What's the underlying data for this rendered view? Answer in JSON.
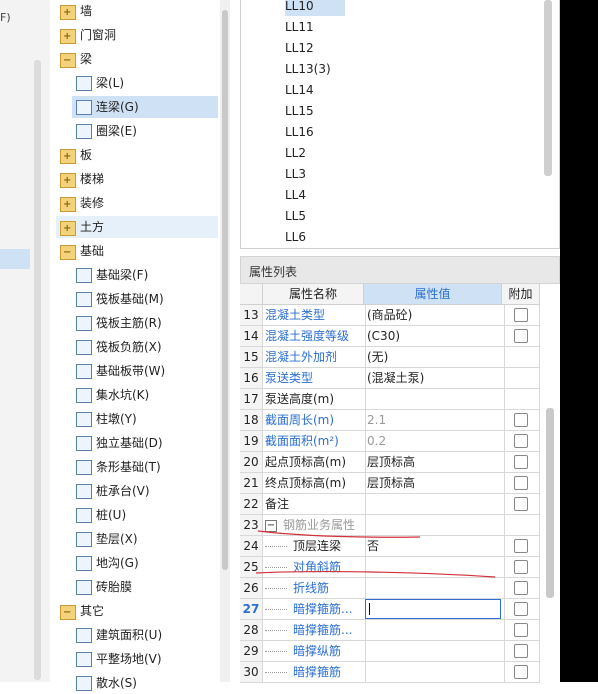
{
  "left_strip": {
    "fragment": "F)"
  },
  "tree": {
    "items": [
      {
        "label": "墙",
        "type": "folder",
        "icon": "folder-plus-icon"
      },
      {
        "label": "门窗洞",
        "type": "folder",
        "icon": "folder-plus-icon"
      },
      {
        "label": "梁",
        "type": "folder-open",
        "icon": "folder-minus-icon"
      },
      {
        "label": "梁(L)",
        "type": "leaf",
        "icon": "beam-icon"
      },
      {
        "label": "连梁(G)",
        "type": "leaf",
        "icon": "link-beam-icon",
        "selected": true
      },
      {
        "label": "圈梁(E)",
        "type": "leaf",
        "icon": "ring-beam-icon"
      },
      {
        "label": "板",
        "type": "folder",
        "icon": "folder-plus-icon"
      },
      {
        "label": "楼梯",
        "type": "folder",
        "icon": "folder-plus-icon"
      },
      {
        "label": "装修",
        "type": "folder",
        "icon": "folder-plus-icon"
      },
      {
        "label": "土方",
        "type": "folder",
        "icon": "folder-plus-icon",
        "hover": true
      },
      {
        "label": "基础",
        "type": "folder-open",
        "icon": "folder-minus-icon"
      },
      {
        "label": "基础梁(F)",
        "type": "leaf",
        "icon": "foundation-beam-icon"
      },
      {
        "label": "筏板基础(M)",
        "type": "leaf",
        "icon": "raft-foundation-icon"
      },
      {
        "label": "筏板主筋(R)",
        "type": "leaf",
        "icon": "raft-main-rebar-icon"
      },
      {
        "label": "筏板负筋(X)",
        "type": "leaf",
        "icon": "raft-negative-rebar-icon"
      },
      {
        "label": "基础板带(W)",
        "type": "leaf",
        "icon": "foundation-strip-icon"
      },
      {
        "label": "集水坑(K)",
        "type": "leaf",
        "icon": "sump-pit-icon"
      },
      {
        "label": "柱墩(Y)",
        "type": "leaf",
        "icon": "column-pier-icon"
      },
      {
        "label": "独立基础(D)",
        "type": "leaf",
        "icon": "isolated-footing-icon"
      },
      {
        "label": "条形基础(T)",
        "type": "leaf",
        "icon": "strip-footing-icon"
      },
      {
        "label": "桩承台(V)",
        "type": "leaf",
        "icon": "pile-cap-icon"
      },
      {
        "label": "桩(U)",
        "type": "leaf",
        "icon": "pile-icon"
      },
      {
        "label": "垫层(X)",
        "type": "leaf",
        "icon": "cushion-icon"
      },
      {
        "label": "地沟(G)",
        "type": "leaf",
        "icon": "trench-icon"
      },
      {
        "label": "砖胎膜",
        "type": "leaf",
        "icon": "brick-mold-icon"
      },
      {
        "label": "其它",
        "type": "folder-open",
        "icon": "folder-minus-icon"
      },
      {
        "label": "建筑面积(U)",
        "type": "leaf",
        "icon": "building-area-icon"
      },
      {
        "label": "平整场地(V)",
        "type": "leaf",
        "icon": "site-leveling-icon"
      },
      {
        "label": "散水(S)",
        "type": "leaf",
        "icon": "apron-icon"
      }
    ]
  },
  "component_list": {
    "items": [
      "LL10",
      "LL11",
      "LL12",
      "LL13(3)",
      "LL14",
      "LL15",
      "LL16",
      "LL2",
      "LL3",
      "LL4",
      "LL5",
      "LL6"
    ],
    "selected": "LL10"
  },
  "properties": {
    "title": "属性列表",
    "columns": {
      "name": "属性名称",
      "value": "属性值",
      "extra": "附加"
    },
    "rows": [
      {
        "num": "13",
        "name": "混凝土类型",
        "value": "(商品砼)",
        "style": "blue",
        "check": true
      },
      {
        "num": "14",
        "name": "混凝土强度等级",
        "value": "(C30)",
        "style": "blue",
        "check": true
      },
      {
        "num": "15",
        "name": "混凝土外加剂",
        "value": "(无)",
        "style": "blue",
        "check": false
      },
      {
        "num": "16",
        "name": "泵送类型",
        "value": "(混凝土泵)",
        "style": "blue",
        "check": false
      },
      {
        "num": "17",
        "name": "泵送高度(m)",
        "value": "",
        "style": "normal",
        "check": false
      },
      {
        "num": "18",
        "name": "截面周长(m)",
        "value": "2.1",
        "style": "blue",
        "valstyle": "gray",
        "check": true
      },
      {
        "num": "19",
        "name": "截面面积(m²)",
        "value": "0.2",
        "style": "blue",
        "valstyle": "gray",
        "check": true
      },
      {
        "num": "20",
        "name": "起点顶标高(m)",
        "value": "层顶标高",
        "style": "normal",
        "check": true
      },
      {
        "num": "21",
        "name": "终点顶标高(m)",
        "value": "层顶标高",
        "style": "normal",
        "check": true
      },
      {
        "num": "22",
        "name": "备注",
        "value": "",
        "style": "normal",
        "check": true
      },
      {
        "num": "23",
        "name": "钢筋业务属性",
        "value": "",
        "style": "group",
        "check": false
      },
      {
        "num": "24",
        "name": "顶层连梁",
        "value": "否",
        "style": "child",
        "check": true
      },
      {
        "num": "25",
        "name": "对角斜筋",
        "value": "",
        "style": "child-blue",
        "check": true
      },
      {
        "num": "26",
        "name": "折线筋",
        "value": "",
        "style": "child-blue",
        "check": true
      },
      {
        "num": "27",
        "name": "暗撑箍筋...",
        "value": "",
        "style": "child-blue",
        "check": true,
        "editing": true,
        "active": true
      },
      {
        "num": "28",
        "name": "暗撑箍筋...",
        "value": "",
        "style": "child-blue",
        "check": true
      },
      {
        "num": "29",
        "name": "暗撑纵筋",
        "value": "",
        "style": "child-blue",
        "check": true
      },
      {
        "num": "30",
        "name": "暗撑箍筋",
        "value": "",
        "style": "child-blue",
        "check": true
      }
    ]
  },
  "colors": {
    "selection": "#cfe1f5",
    "link_blue": "#2b6fd1",
    "annotation_red": "#d2303a"
  }
}
